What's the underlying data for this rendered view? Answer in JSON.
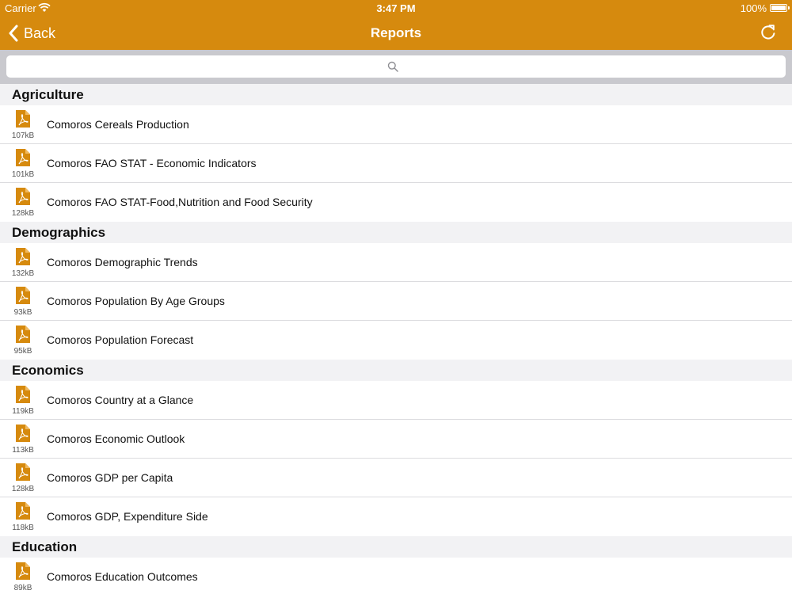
{
  "status": {
    "carrier": "Carrier",
    "time": "3:47 PM",
    "battery": "100%"
  },
  "nav": {
    "back_label": "Back",
    "title": "Reports"
  },
  "search": {
    "placeholder": ""
  },
  "colors": {
    "accent": "#D68A0E",
    "section_bg": "#F2F2F4",
    "search_bg": "#C9C9CE"
  },
  "sections": [
    {
      "title": "Agriculture",
      "items": [
        {
          "title": "Comoros Cereals Production",
          "size": "107kB"
        },
        {
          "title": "Comoros FAO STAT - Economic Indicators",
          "size": "101kB"
        },
        {
          "title": "Comoros FAO STAT-Food,Nutrition and Food Security",
          "size": "128kB"
        }
      ]
    },
    {
      "title": "Demographics",
      "items": [
        {
          "title": "Comoros Demographic Trends",
          "size": "132kB"
        },
        {
          "title": "Comoros Population By Age Groups",
          "size": "93kB"
        },
        {
          "title": "Comoros Population Forecast",
          "size": "95kB"
        }
      ]
    },
    {
      "title": "Economics",
      "items": [
        {
          "title": "Comoros Country at a Glance",
          "size": "119kB"
        },
        {
          "title": "Comoros Economic Outlook",
          "size": "113kB"
        },
        {
          "title": "Comoros GDP per Capita",
          "size": "128kB"
        },
        {
          "title": "Comoros GDP, Expenditure Side",
          "size": "118kB"
        }
      ]
    },
    {
      "title": "Education",
      "items": [
        {
          "title": "Comoros Education Outcomes",
          "size": "89kB"
        }
      ]
    }
  ]
}
